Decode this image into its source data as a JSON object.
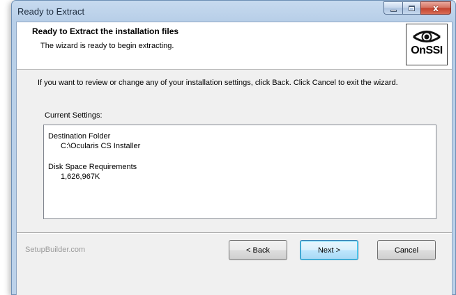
{
  "window": {
    "title": "Ready to Extract",
    "controls": {
      "minimize": "minimize",
      "maximize": "maximize",
      "close": "x"
    }
  },
  "header": {
    "title": "Ready to Extract the installation files",
    "subtitle": "The wizard is ready to begin extracting.",
    "logo_text": "OnSSI"
  },
  "body": {
    "intro": "If you want to review or change any of your installation settings, click Back. Click Cancel to exit the wizard.",
    "settings_label": "Current Settings:",
    "settings": [
      {
        "label": "Destination Folder",
        "value": "C:\\Ocularis CS Installer"
      },
      {
        "label": "Disk Space Requirements",
        "value": "1,626,967K"
      }
    ]
  },
  "footer": {
    "brand": "SetupBuilder.com",
    "back": "< Back",
    "next": "Next >",
    "cancel": "Cancel"
  }
}
